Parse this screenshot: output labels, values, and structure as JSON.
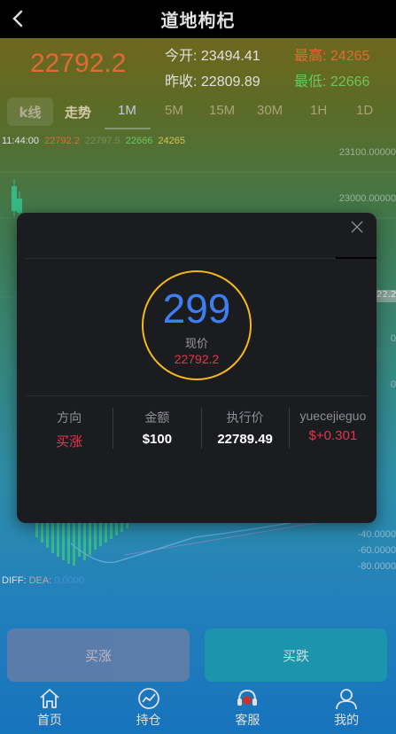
{
  "header": {
    "title": "道地枸杞",
    "back_icon": "chevron-left-icon"
  },
  "quote": {
    "current": "22792.2",
    "open_label": "今开:",
    "open": "23494.41",
    "prev_label": "昨收:",
    "prev": "22809.89",
    "high_label": "最高:",
    "high": "24265",
    "low_label": "最低:",
    "low": "22666"
  },
  "tabs": {
    "kline": "k线",
    "trend": "走势",
    "timeframes": [
      "1M",
      "5M",
      "15M",
      "30M",
      "1H",
      "1D"
    ],
    "active": "1M"
  },
  "chart": {
    "time": "11:44:00",
    "o": "22792.2",
    "c": "22797.5",
    "l": "22666",
    "h": "24265",
    "y_labels": [
      "23100.00000",
      "23000.00000",
      "22.2",
      "0",
      "0",
      "-40.0000",
      "-60.0000",
      "-80.0000"
    ],
    "macd_diff": "DIFF:",
    "macd_dea": "DEA:",
    "macd_val": "0.0000"
  },
  "actions": {
    "buy_up": "买涨",
    "buy_down": "买跌"
  },
  "nav": [
    {
      "label": "首页",
      "icon": "home-icon"
    },
    {
      "label": "持仓",
      "icon": "position-chart-icon"
    },
    {
      "label": "客服",
      "icon": "headset-icon"
    },
    {
      "label": "我的",
      "icon": "user-icon"
    }
  ],
  "modal": {
    "countdown": "299",
    "current_label": "现价",
    "current_price": "22792.2",
    "columns": [
      {
        "header": "方向",
        "value": "买涨"
      },
      {
        "header": "金额",
        "value": "$100"
      },
      {
        "header": "执行价",
        "value": "22789.49"
      },
      {
        "header": "yuecejieguo",
        "value": "$+0.301"
      }
    ]
  },
  "colors": {
    "accent_orange": "#ff7a3c",
    "low_green": "#7ee06a",
    "ring_gold": "#f5b81a",
    "count_blue": "#3d7ff2",
    "profit_red": "#e8344a"
  }
}
